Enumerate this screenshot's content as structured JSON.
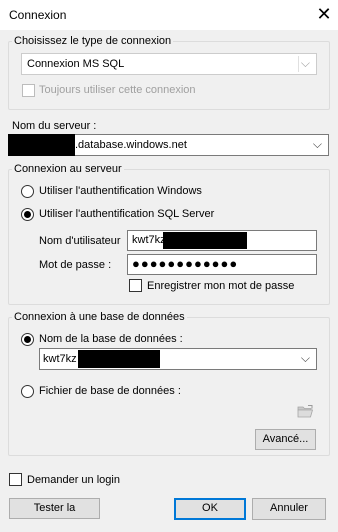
{
  "window": {
    "title": "Connexion",
    "close_glyph": "✕"
  },
  "connection_type": {
    "legend": "Choisissez le type de connexion",
    "selected": "Connexion MS SQL",
    "always_use_label": "Toujours utiliser cette connexion",
    "always_use_checked": false
  },
  "server": {
    "label": "Nom du serveur :",
    "value_suffix": ".database.windows.net"
  },
  "auth": {
    "legend": "Connexion au serveur",
    "windows_label": "Utiliser l'authentification Windows",
    "sql_label": "Utiliser l'authentification SQL Server",
    "selected": "sql",
    "username_label": "Nom d'utilisateur",
    "username_value": "kwt7kz",
    "password_label": "Mot de passe :",
    "password_mask": "●●●●●●●●●●●●",
    "remember_label": "Enregistrer mon mot de passe",
    "remember_checked": false
  },
  "database": {
    "legend": "Connexion à une base de données",
    "name_label": "Nom de la base de données :",
    "name_value": "kwt7kz",
    "file_label": "Fichier de base de données :",
    "selected": "name",
    "advanced_button": "Avancé..."
  },
  "footer": {
    "ask_login_label": "Demander un login",
    "ask_login_checked": false,
    "test_button": "Tester la",
    "ok_button": "OK",
    "cancel_button": "Annuler"
  },
  "icons": {
    "dropdown": "chevron-down-icon",
    "folder": "open-folder-icon"
  }
}
